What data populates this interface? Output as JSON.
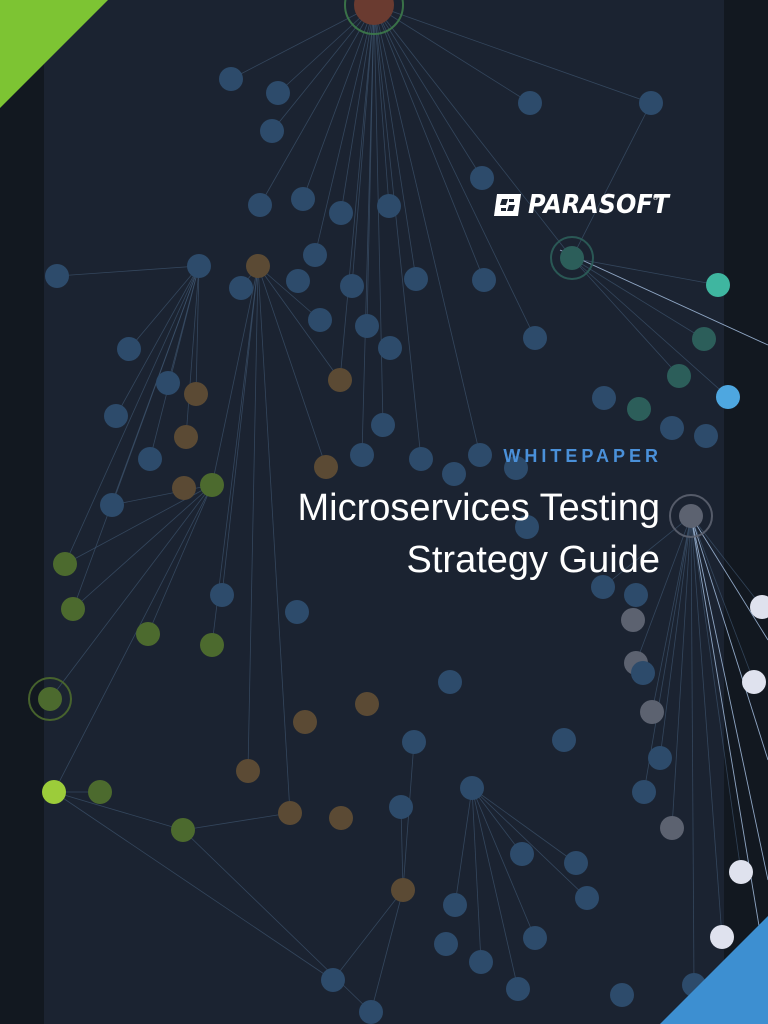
{
  "brand": {
    "name": "PARASOFT",
    "mark": "®",
    "icon": "parasoft-logo-icon"
  },
  "cover": {
    "eyebrow": "WHITEPAPER",
    "title_lines": [
      "Microservices Testing",
      "Strategy Guide"
    ]
  },
  "colors": {
    "background": "#1b2331",
    "accent_green": "#7dc433",
    "accent_blue": "#3d8fd1",
    "eyebrow_text": "#4a90d9",
    "title_text": "#ffffff"
  }
}
